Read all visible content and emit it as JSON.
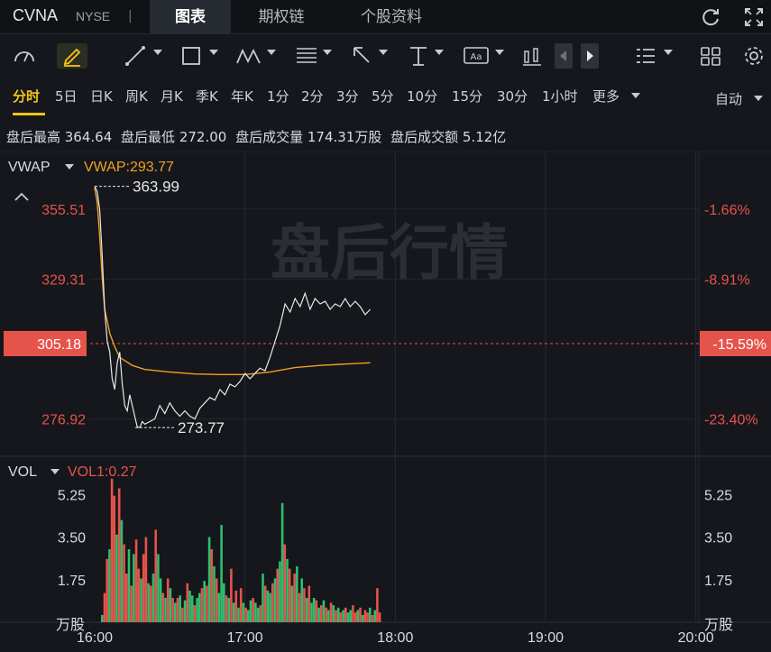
{
  "header": {
    "ticker": "CVNA",
    "exchange": "NYSE",
    "separator": "|",
    "tabs": [
      "图表",
      "期权链",
      "个股资料"
    ],
    "active_tab": "图表"
  },
  "toolbar": {
    "icons": [
      "gauge-icon",
      "draw-pen-icon",
      "line-tool-icon",
      "rectangle-tool-icon",
      "pattern-tool-icon",
      "fib-tool-icon",
      "arrow-tool-icon",
      "measure-tool-icon",
      "text-tool-icon",
      "candle-type-icon",
      "prev-icon",
      "next-icon",
      "layout-list-icon",
      "grid-icon",
      "settings-icon"
    ]
  },
  "periods": {
    "items": [
      "分时",
      "5日",
      "日K",
      "周K",
      "月K",
      "季K",
      "年K",
      "1分",
      "2分",
      "3分",
      "5分",
      "10分",
      "15分",
      "30分",
      "1小时",
      "更多"
    ],
    "active": "分时",
    "mode": "自动"
  },
  "stats": {
    "high": "盘后最高 364.64",
    "low": "盘后最低 272.00",
    "volume": "盘后成交量 174.31万股",
    "amount": "盘后成交额 5.12亿"
  },
  "price_panel": {
    "indicator": "VWAP",
    "indicator_value": "VWAP:293.77",
    "watermark": "盘后行情",
    "current_price": "305.18",
    "current_pct": "-15.59%",
    "high_marker": "363.99",
    "low_marker": "273.77"
  },
  "volume_panel": {
    "indicator": "VOL",
    "indicator_value": "VOL1:0.27",
    "unit": "万股"
  },
  "colors": {
    "up": "#2ebd6f",
    "down": "#e5534b",
    "vwap": "#f0a020",
    "accent": "#f5c518",
    "price_line": "#e8e8e8"
  },
  "chart_data": [
    {
      "type": "line",
      "title": "",
      "x_ticks": [
        "16:00",
        "17:00",
        "18:00",
        "19:00",
        "20:00"
      ],
      "y_ticks_left": [
        "355.51",
        "329.31",
        "305.18",
        "276.92"
      ],
      "y_ticks_right": [
        "-1.66%",
        "-8.91%",
        "-15.59%",
        "-23.40%"
      ],
      "ylim": [
        263,
        375
      ],
      "series": [
        {
          "name": "VWAP",
          "x": [
            "16:00",
            "16:01",
            "16:02",
            "16:03",
            "16:04",
            "16:06",
            "16:08",
            "16:10",
            "16:15",
            "16:20",
            "16:30",
            "16:40",
            "16:50",
            "17:00",
            "17:10",
            "17:20",
            "17:30",
            "17:40",
            "17:50"
          ],
          "values": [
            363.5,
            358,
            345,
            330,
            318,
            309,
            304,
            300,
            297,
            295.5,
            294.5,
            293.8,
            293.6,
            293.6,
            294.5,
            296.2,
            297,
            297.5,
            298
          ]
        },
        {
          "x": [
            "16:00",
            "16:01",
            "16:02",
            "16:03",
            "16:04",
            "16:05",
            "16:06",
            "16:07",
            "16:08",
            "16:09",
            "16:10",
            "16:11",
            "16:12",
            "16:13",
            "16:14",
            "16:15",
            "16:16",
            "16:17",
            "16:18",
            "16:19",
            "16:20",
            "16:22",
            "16:24",
            "16:26",
            "16:28",
            "16:30",
            "16:32",
            "16:34",
            "16:36",
            "16:38",
            "16:40",
            "16:42",
            "16:44",
            "16:46",
            "16:48",
            "16:50",
            "16:52",
            "16:54",
            "16:56",
            "16:58",
            "17:00",
            "17:02",
            "17:04",
            "17:06",
            "17:08",
            "17:10",
            "17:12",
            "17:14",
            "17:16",
            "17:18",
            "17:20",
            "17:22",
            "17:24",
            "17:26",
            "17:28",
            "17:30",
            "17:32",
            "17:34",
            "17:36",
            "17:38",
            "17:40",
            "17:42",
            "17:44",
            "17:46",
            "17:48",
            "17:50"
          ],
          "values": [
            363.99,
            362,
            355,
            338,
            318,
            306,
            302,
            292,
            288,
            298,
            302,
            290,
            282,
            280,
            286,
            282,
            278,
            274,
            273.77,
            276,
            275,
            276,
            277,
            282,
            279,
            283,
            280,
            278,
            280,
            278,
            277,
            281,
            283,
            285,
            284,
            288,
            286,
            290,
            289,
            291,
            294,
            292,
            294,
            296,
            295,
            300,
            306,
            312,
            320,
            317,
            322,
            319,
            324,
            318,
            322,
            320,
            321,
            318,
            320,
            319,
            322,
            319,
            321,
            319,
            316,
            318
          ]
        }
      ]
    },
    {
      "type": "bar",
      "title": "",
      "x_ticks": [
        "16:00",
        "17:00",
        "18:00",
        "19:00",
        "20:00"
      ],
      "y_ticks": [
        "5.25",
        "3.50",
        "1.75"
      ],
      "ylim": [
        0,
        6.3
      ],
      "series": [
        {
          "name": "VOL",
          "values": [
            0.3,
            1.2,
            2.6,
            3.0,
            5.9,
            5.2,
            3.6,
            5.5,
            4.2,
            3.2,
            2.0,
            3.0,
            1.5,
            2.8,
            3.4,
            2.2,
            1.8,
            2.8,
            3.5,
            1.6,
            1.5,
            2.0,
            3.8,
            2.8,
            1.8,
            1.2,
            1.0,
            1.8,
            1.4,
            1.0,
            0.8,
            1.0,
            1.1,
            0.6,
            0.9,
            1.6,
            1.3,
            1.1,
            0.7,
            1.0,
            1.2,
            1.4,
            1.7,
            1.5,
            3.5,
            3.0,
            2.3,
            1.8,
            1.2,
            4.0,
            1.6,
            1.1,
            1.0,
            2.2,
            0.8,
            1.3,
            0.6,
            1.4,
            0.8,
            0.6,
            0.5,
            0.9,
            1.0,
            0.8,
            0.6,
            0.7,
            2.0,
            1.5,
            1.3,
            1.2,
            1.6,
            1.8,
            2.2,
            2.5,
            4.9,
            3.2,
            2.6,
            2.2,
            1.5,
            2.0,
            2.3,
            1.2,
            1.8,
            1.4,
            1.0,
            1.5,
            0.8,
            1.0,
            0.9,
            0.6,
            0.7,
            0.9,
            0.6,
            0.5,
            0.8,
            0.7,
            0.5,
            0.6,
            0.4,
            0.5,
            0.6,
            0.4,
            0.5,
            0.7,
            0.4,
            0.5,
            0.6,
            0.3,
            0.5,
            0.4,
            0.6,
            0.3,
            0.5,
            1.4,
            0.4
          ],
          "colors": [
            "u",
            "d",
            "d",
            "u",
            "d",
            "d",
            "u",
            "d",
            "u",
            "d",
            "d",
            "u",
            "d",
            "u",
            "d",
            "d",
            "u",
            "d",
            "d",
            "u",
            "d",
            "u",
            "d",
            "u",
            "u",
            "d",
            "u",
            "d",
            "u",
            "d",
            "u",
            "d",
            "u",
            "d",
            "u",
            "d",
            "u",
            "u",
            "d",
            "u",
            "u",
            "d",
            "u",
            "d",
            "u",
            "d",
            "u",
            "d",
            "u",
            "u",
            "u",
            "d",
            "u",
            "d",
            "u",
            "d",
            "u",
            "d",
            "u",
            "d",
            "u",
            "u",
            "d",
            "u",
            "u",
            "d",
            "u",
            "d",
            "u",
            "u",
            "d",
            "u",
            "d",
            "u",
            "u",
            "d",
            "u",
            "d",
            "u",
            "d",
            "u",
            "d",
            "u",
            "d",
            "u",
            "d",
            "u",
            "u",
            "d",
            "u",
            "d",
            "u",
            "d",
            "u",
            "d",
            "u",
            "d",
            "u",
            "d",
            "u",
            "d",
            "u",
            "u",
            "d",
            "d",
            "u",
            "d",
            "u",
            "d",
            "d",
            "u",
            "d",
            "u",
            "d",
            "d"
          ]
        }
      ]
    }
  ]
}
